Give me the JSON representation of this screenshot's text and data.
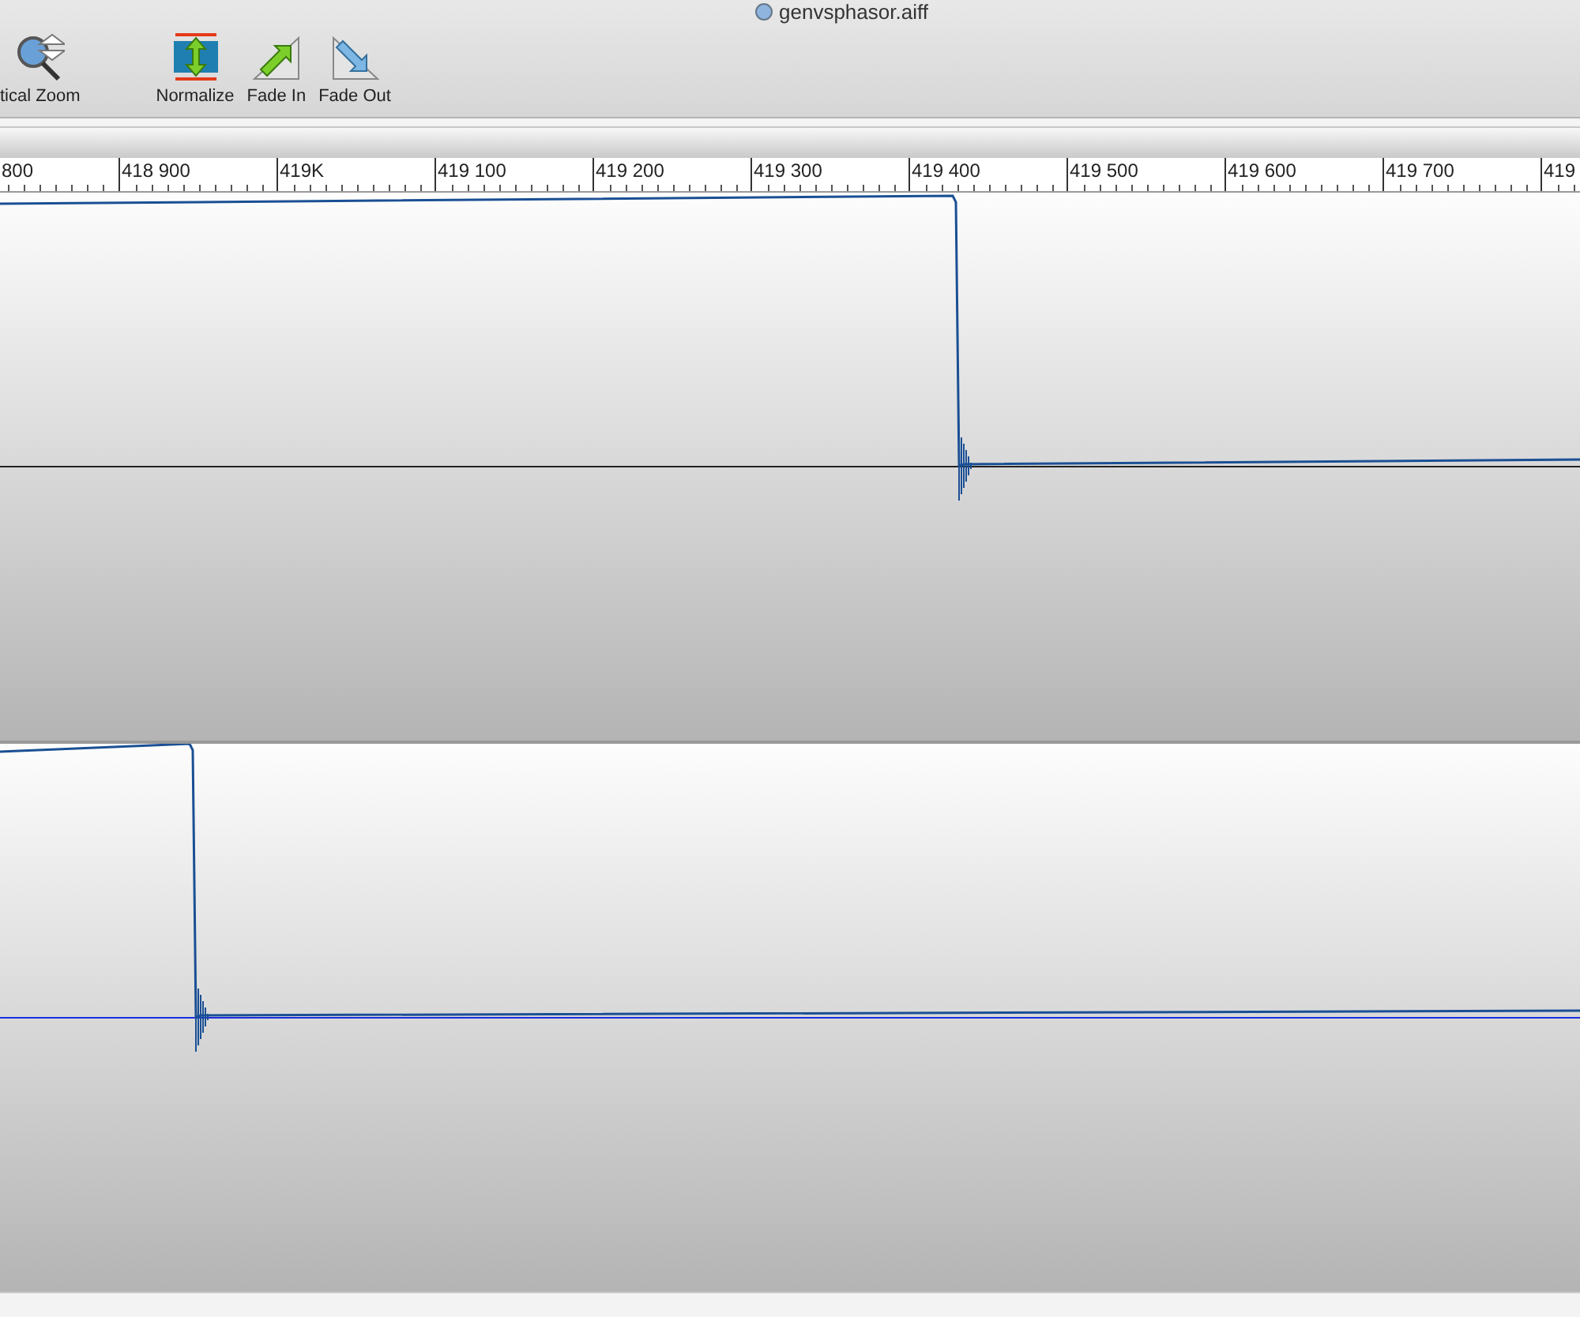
{
  "window": {
    "title": "genvsphasor.aiff"
  },
  "toolbar": [
    {
      "kind": "zoom",
      "label": "tical Zoom"
    },
    {
      "kind": "normalize",
      "label": "Normalize"
    },
    {
      "kind": "fade-in",
      "label": "Fade In"
    },
    {
      "kind": "fade-out",
      "label": "Fade Out"
    }
  ],
  "ruler": {
    "labels": [
      "800",
      "418 900",
      "419K",
      "419 100",
      "419 200",
      "419 300",
      "419 400",
      "419 500",
      "419 600",
      "419 700",
      "419"
    ]
  },
  "tracks": [
    {
      "kind": "step-down-late"
    },
    {
      "kind": "step-down-early"
    }
  ]
}
